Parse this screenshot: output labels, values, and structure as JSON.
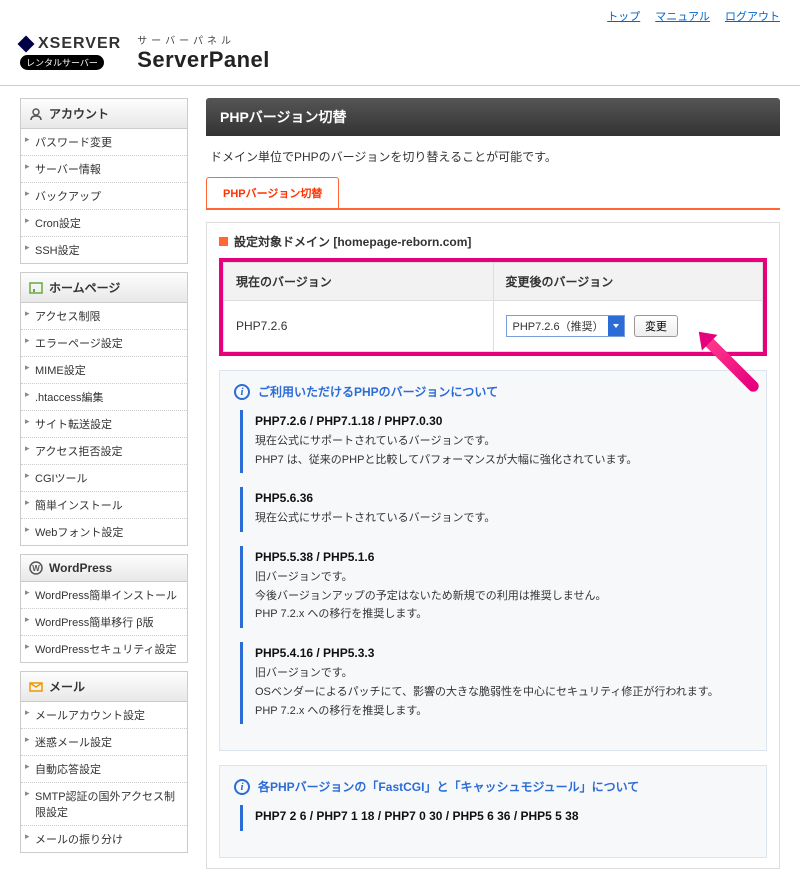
{
  "top_links": {
    "top": "トップ",
    "manual": "マニュアル",
    "logout": "ログアウト"
  },
  "header": {
    "brand": "XSERVER",
    "badge": "レンタルサーバー",
    "panel_sub": "サーバーパネル",
    "panel_main": "ServerPanel"
  },
  "sidebar": {
    "groups": [
      {
        "title": "アカウント",
        "items": [
          "パスワード変更",
          "サーバー情報",
          "バックアップ",
          "Cron設定",
          "SSH設定"
        ]
      },
      {
        "title": "ホームページ",
        "items": [
          "アクセス制限",
          "エラーページ設定",
          "MIME設定",
          ".htaccess編集",
          "サイト転送設定",
          "アクセス拒否設定",
          "CGIツール",
          "簡単インストール",
          "Webフォント設定"
        ]
      },
      {
        "title": "WordPress",
        "items": [
          "WordPress簡単インストール",
          "WordPress簡単移行 β版",
          "WordPressセキュリティ設定"
        ]
      },
      {
        "title": "メール",
        "items": [
          "メールアカウント設定",
          "迷惑メール設定",
          "自動応答設定",
          "SMTP認証の国外アクセス制限設定",
          "メールの振り分け"
        ]
      }
    ]
  },
  "page": {
    "title": "PHPバージョン切替",
    "desc": "ドメイン単位でPHPのバージョンを切り替えることが可能です。",
    "tab": "PHPバージョン切替",
    "target_label": "設定対象ドメイン",
    "target_domain": "[homepage-reborn.com]",
    "col_current": "現在のバージョン",
    "col_after": "変更後のバージョン",
    "current_value": "PHP7.2.6",
    "select_value": "PHP7.2.6（推奨）",
    "change_btn": "変更"
  },
  "info": {
    "title": "ご利用いただけるPHPのバージョンについて",
    "blocks": [
      {
        "title": "PHP7.2.6 / PHP7.1.18 / PHP7.0.30",
        "lines": [
          "現在公式にサポートされているバージョンです。",
          "PHP7 は、従来のPHPと比較してパフォーマンスが大幅に強化されています。"
        ]
      },
      {
        "title": "PHP5.6.36",
        "lines": [
          "現在公式にサポートされているバージョンです。"
        ]
      },
      {
        "title": "PHP5.5.38 / PHP5.1.6",
        "lines": [
          "旧バージョンです。",
          "今後バージョンアップの予定はないため新規での利用は推奨しません。",
          "PHP 7.2.x への移行を推奨します。"
        ]
      },
      {
        "title": "PHP5.4.16 / PHP5.3.3",
        "lines": [
          "旧バージョンです。",
          "OSベンダーによるパッチにて、影響の大きな脆弱性を中心にセキュリティ修正が行われます。",
          "PHP 7.2.x への移行を推奨します。"
        ]
      }
    ]
  },
  "info2": {
    "title": "各PHPバージョンの「FastCGI」と「キャッシュモジュール」について",
    "line": "PHP7 2 6 / PHP7 1 18 / PHP7 0 30 / PHP5 6 36 / PHP5 5 38"
  }
}
